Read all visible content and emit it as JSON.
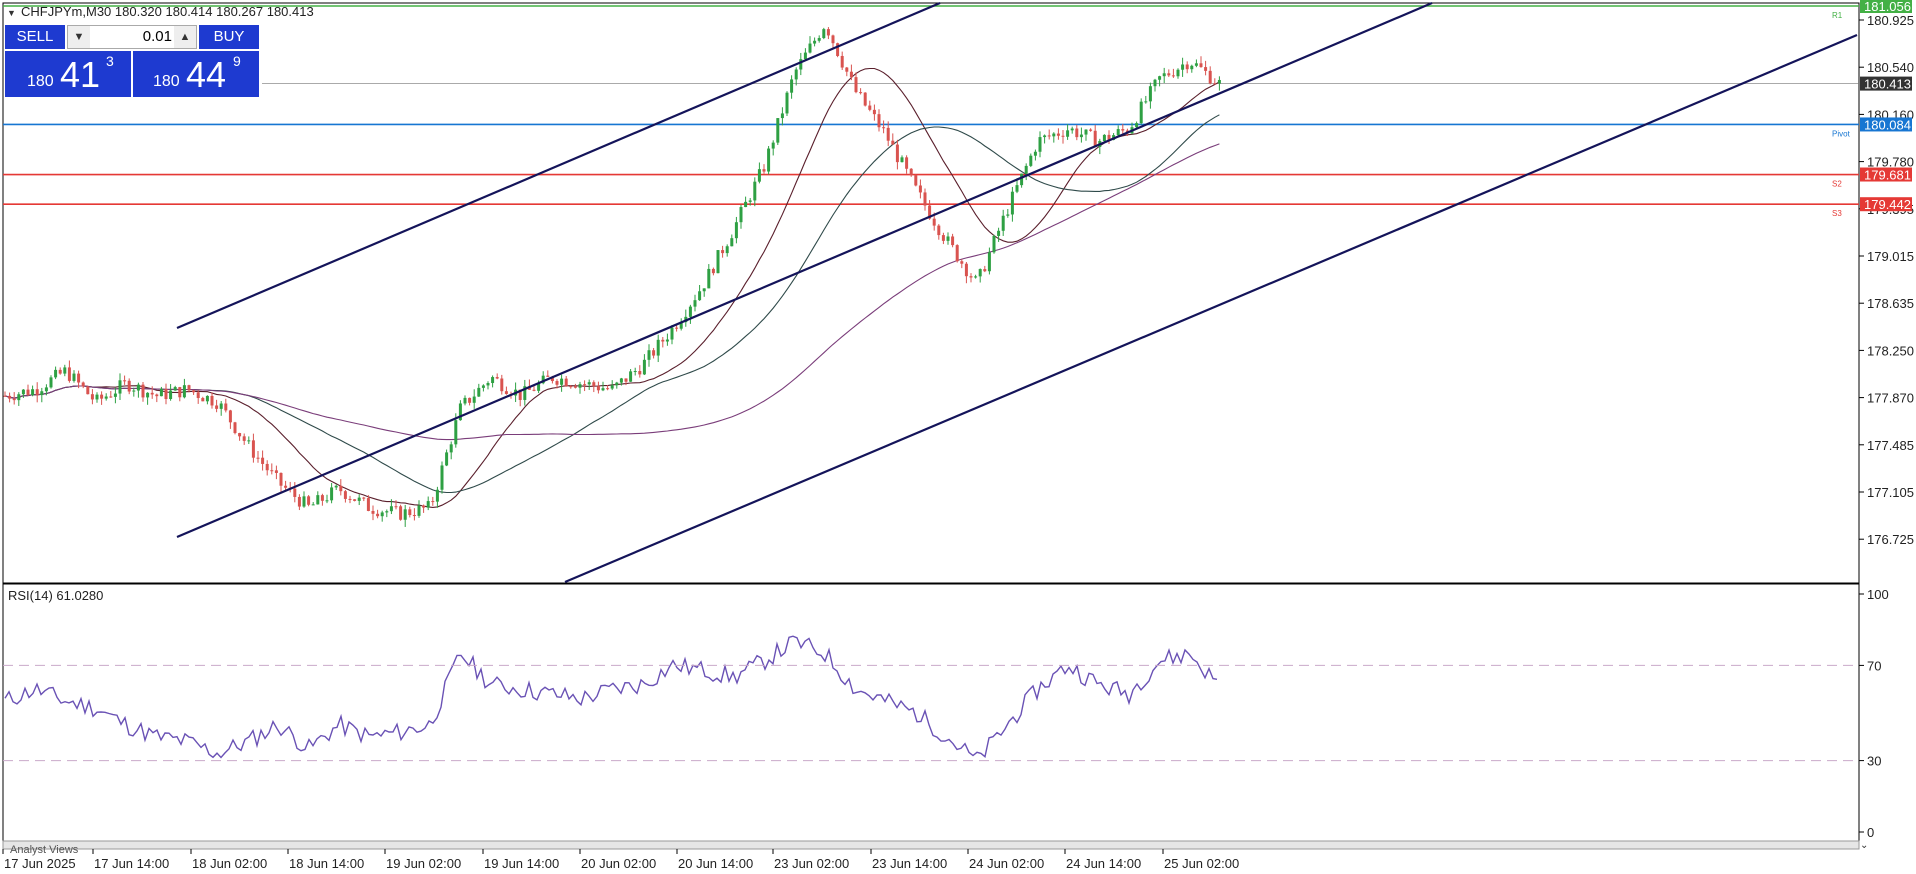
{
  "symbol_header": "CHFJPYm,M30  180.320 180.414 180.267 180.413",
  "trade": {
    "sell_label": "SELL",
    "buy_label": "BUY",
    "volume": "0.01",
    "sell_prefix": "180",
    "sell_big": "41",
    "sell_sup": "3",
    "buy_prefix": "180",
    "buy_big": "44",
    "buy_sup": "9"
  },
  "price_axis": {
    "ticks": [
      "180.925",
      "180.540",
      "180.160",
      "179.780",
      "179.395",
      "179.015",
      "178.635",
      "178.250",
      "177.870",
      "177.485",
      "177.105",
      "176.725"
    ],
    "tags": [
      {
        "label": "181.056",
        "color": "#43b045",
        "price": 181.056
      },
      {
        "label": "180.413",
        "color": "#333333",
        "price": 180.413
      },
      {
        "label": "180.084",
        "color": "#1776d2",
        "price": 180.084
      },
      {
        "label": "179.681",
        "color": "#e53935",
        "price": 179.681
      },
      {
        "label": "179.442",
        "color": "#e53935",
        "price": 179.442
      }
    ]
  },
  "levels": [
    {
      "name": "R1",
      "price": 181.056,
      "color": "#43b045"
    },
    {
      "name": "Pivot",
      "price": 180.084,
      "color": "#1776d2"
    },
    {
      "name": "S2",
      "price": 179.681,
      "color": "#e53935"
    },
    {
      "name": "S3",
      "price": 179.442,
      "color": "#e53935"
    }
  ],
  "bid_price": 180.413,
  "rsi": {
    "title": "RSI(14) 61.0280",
    "ticks": [
      "100",
      "70",
      "30",
      "0"
    ],
    "levels": [
      70,
      30
    ]
  },
  "time_axis": {
    "labels": [
      "17 Jun 2025",
      "17 Jun 14:00",
      "18 Jun 02:00",
      "18 Jun 14:00",
      "19 Jun 02:00",
      "19 Jun 14:00",
      "20 Jun 02:00",
      "20 Jun 14:00",
      "23 Jun 02:00",
      "23 Jun 14:00",
      "24 Jun 02:00",
      "24 Jun 14:00",
      "25 Jun 02:00"
    ]
  },
  "tabs": {
    "analyst_views": "Analyst Views"
  },
  "chart_data": {
    "type": "candlestick",
    "title": "CHFJPYm,M30",
    "ylim": [
      176.6,
      181.1
    ],
    "series": [
      {
        "name": "price_path",
        "values": [
          177.9,
          177.95,
          178.1,
          177.85,
          178.0,
          177.9,
          177.95,
          177.85,
          177.5,
          177.2,
          177.0,
          177.15,
          177.0,
          176.95,
          177.0,
          177.8,
          178.05,
          177.9,
          178.05,
          178.0,
          177.95,
          178.15,
          178.45,
          178.8,
          179.25,
          179.75,
          180.5,
          180.9,
          180.35,
          180.0,
          179.55,
          179.15,
          178.8,
          179.4,
          179.95,
          180.05,
          179.95,
          180.05,
          180.45,
          180.6,
          180.41
        ]
      },
      {
        "name": "rsi",
        "values": [
          55,
          60,
          55,
          52,
          45,
          40,
          38,
          33,
          38,
          45,
          35,
          45,
          40,
          42,
          45,
          75,
          62,
          60,
          58,
          56,
          60,
          62,
          70,
          68,
          65,
          72,
          80,
          75,
          60,
          55,
          50,
          40,
          30,
          45,
          60,
          70,
          62,
          58,
          72,
          75,
          61
        ]
      }
    ],
    "channel": {
      "upper": [
        {
          "x": "17 Jun 14:00",
          "y": 178.58
        },
        {
          "x": "19 Jun 02:00",
          "y": 181.1
        }
      ],
      "middle": [
        {
          "x": "17 Jun 14:00",
          "y": 177.06
        },
        {
          "x": "25 Jun 02:00",
          "y": 180.43
        }
      ],
      "lower": [
        {
          "x": "19 Jun 14:00",
          "y": 176.6
        },
        {
          "x": "25 Jun 14:00",
          "y": 180.94
        }
      ]
    }
  }
}
